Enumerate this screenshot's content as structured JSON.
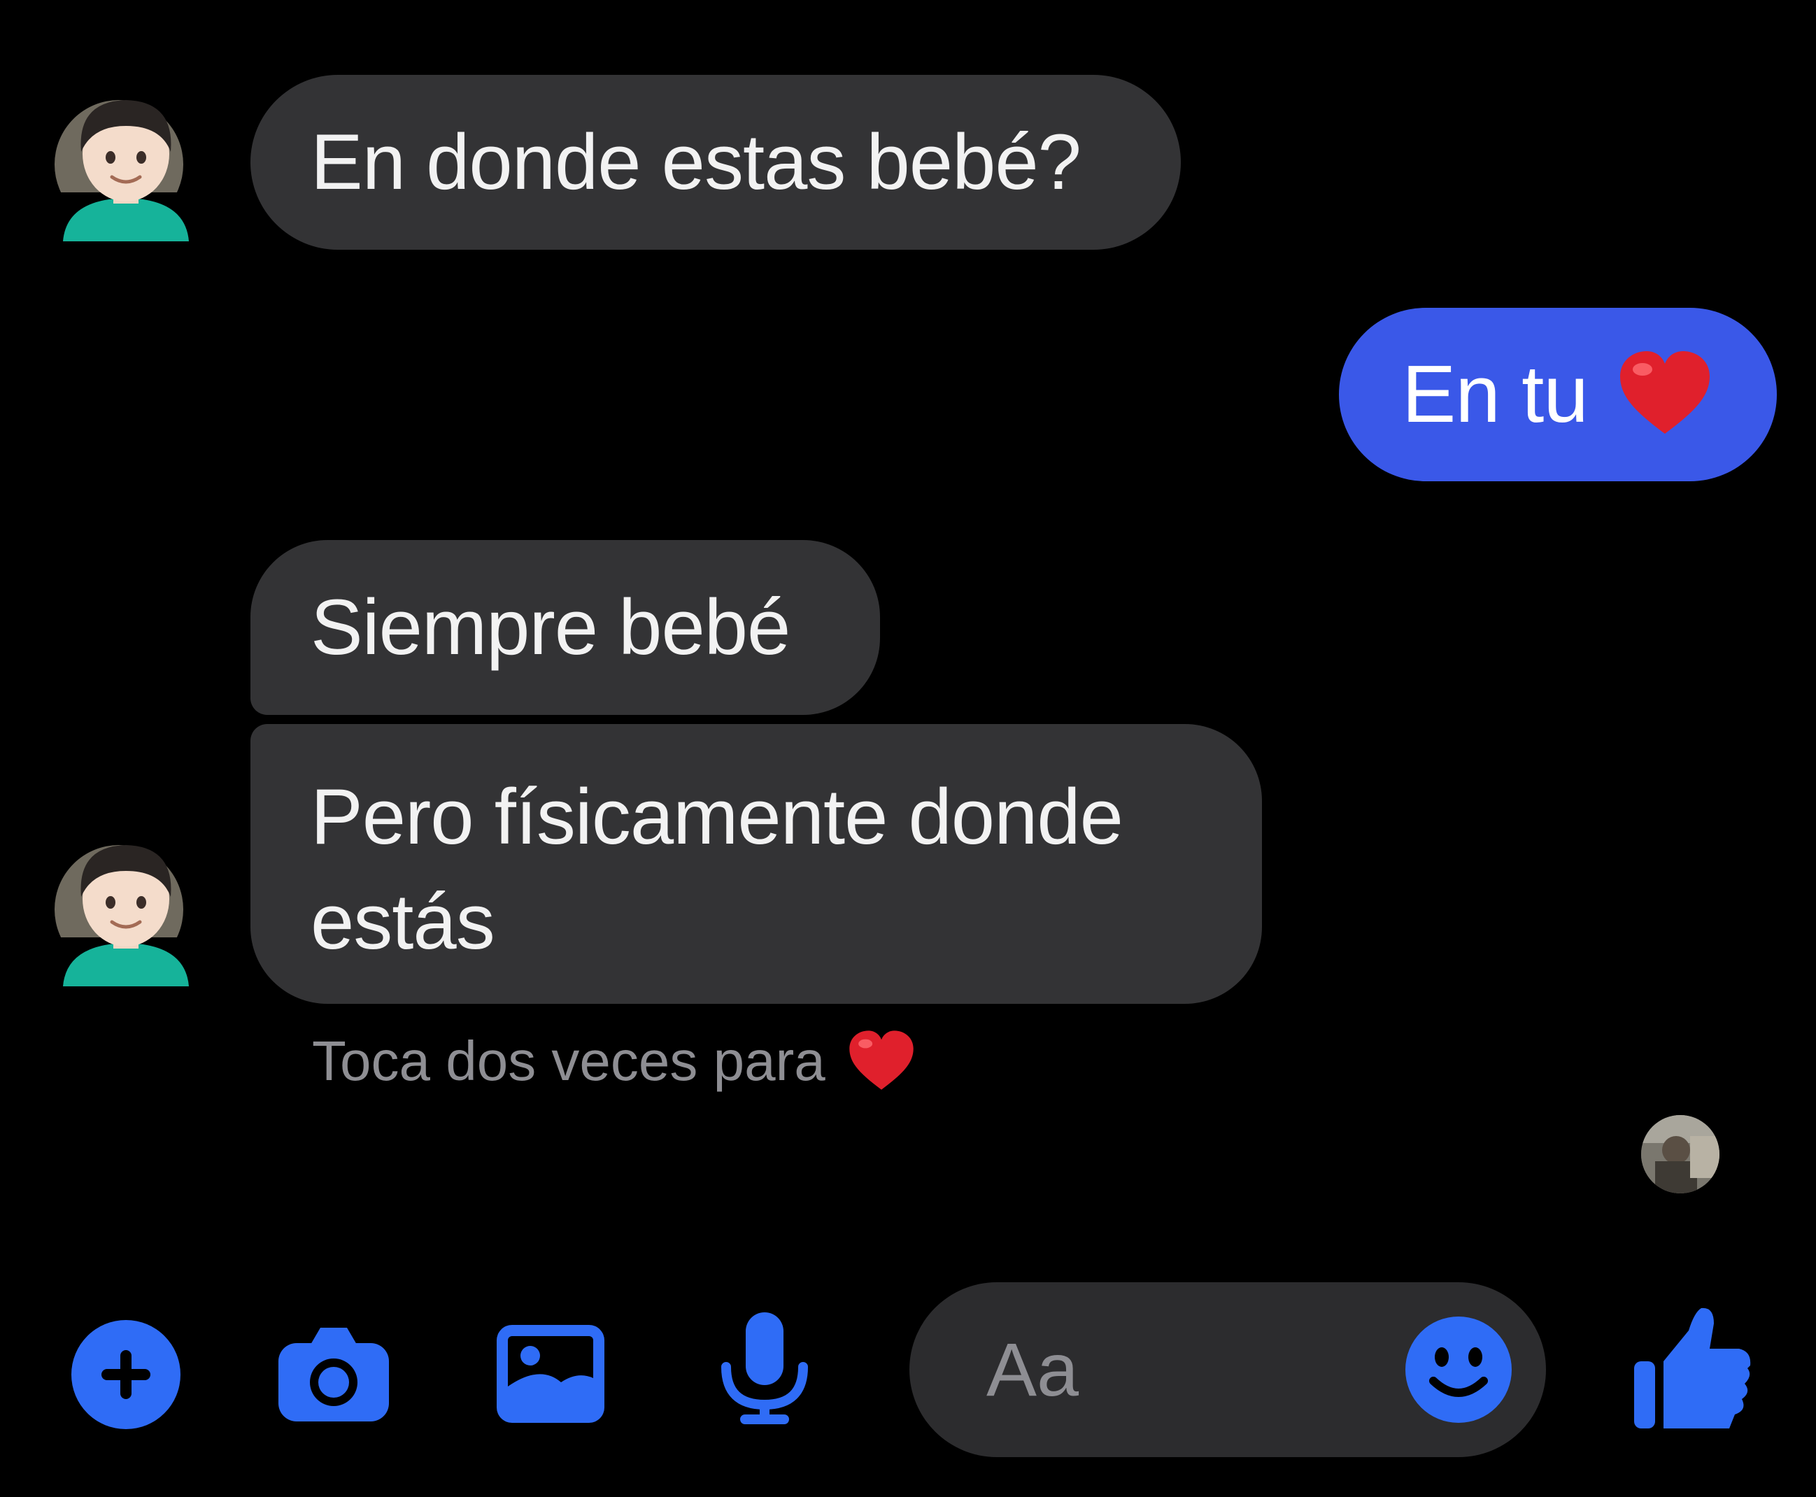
{
  "messages": [
    {
      "direction": "incoming",
      "text": "En donde estas bebé?"
    },
    {
      "direction": "outgoing",
      "text": "En tu",
      "emoji": "red-heart"
    },
    {
      "direction": "incoming",
      "text": "Siempre bebé"
    },
    {
      "direction": "incoming",
      "lines": [
        "Pero físicamente donde",
        "estás"
      ]
    }
  ],
  "reaction_hint": {
    "text": "Toca dos veces para",
    "emoji": "red-heart"
  },
  "composer": {
    "placeholder": "Aa",
    "buttons": [
      "plus-icon",
      "camera-icon",
      "image-icon",
      "microphone-icon"
    ],
    "emoji_button": "smiley-icon",
    "send_button": "thumbs-up-icon"
  },
  "colors": {
    "background": "#000000",
    "incoming_bubble": "#333335",
    "outgoing_bubble": "#3a58e8",
    "accent": "#2f6cf6",
    "hint_text": "#8e8e93"
  }
}
